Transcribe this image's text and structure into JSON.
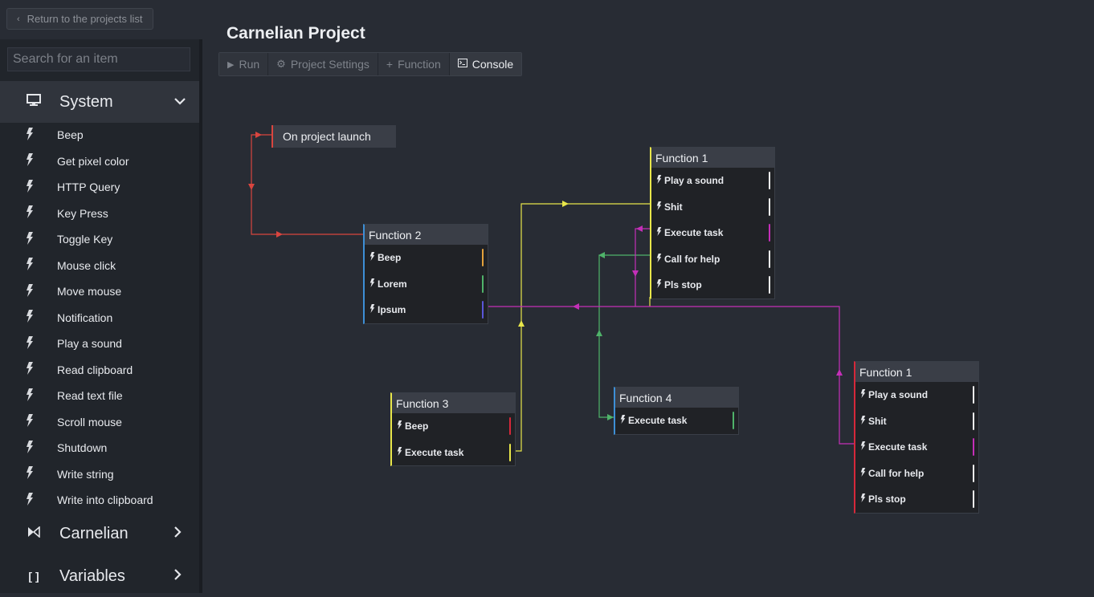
{
  "return_button": {
    "label": "Return to the projects list",
    "icon": "chevron-left-icon"
  },
  "search": {
    "placeholder": "Search for an item"
  },
  "sidebar": {
    "categories": [
      {
        "label": "System",
        "icon": "monitor-icon",
        "expanded": true
      },
      {
        "label": "Carnelian",
        "icon": "carnelian-logo-icon",
        "expanded": false
      },
      {
        "label": "Variables",
        "icon": "brackets-icon",
        "expanded": false
      }
    ],
    "system_items": [
      "Beep",
      "Get pixel color",
      "HTTP Query",
      "Key Press",
      "Toggle Key",
      "Mouse click",
      "Move mouse",
      "Notification",
      "Play a sound",
      "Read clipboard",
      "Read text file",
      "Scroll mouse",
      "Shutdown",
      "Write string",
      "Write into clipboard"
    ]
  },
  "project": {
    "title": "Carnelian Project"
  },
  "toolbar": {
    "run": "Run",
    "settings": "Project Settings",
    "function": "Function",
    "console": "Console"
  },
  "colors": {
    "red": "#d9453f",
    "yellow": "#e8e64a",
    "green": "#4fb36a",
    "magenta": "#c42fb8",
    "blue": "#3d8fd6",
    "orange": "#e3a13b",
    "indigo": "#5a56d9",
    "crimson": "#d6283a",
    "white": "#f0f0f0"
  },
  "canvas": {
    "trigger": {
      "label": "On project launch"
    },
    "nodes": [
      {
        "title": "Function 1",
        "accent": "#e8e64a",
        "rows": [
          {
            "label": "Play a sound",
            "port": "#f0f0f0"
          },
          {
            "label": "Shit",
            "port": "#f0f0f0"
          },
          {
            "label": "Execute task",
            "port": "#c42fb8"
          },
          {
            "label": "Call for help",
            "port": "#f0f0f0"
          },
          {
            "label": "Pls stop",
            "port": "#f0f0f0"
          }
        ]
      },
      {
        "title": "Function 2",
        "accent": "#3d8fd6",
        "rows": [
          {
            "label": "Beep",
            "port": "#e3a13b"
          },
          {
            "label": "Lorem",
            "port": "#4fb36a"
          },
          {
            "label": "Ipsum",
            "port": "#5a56d9"
          }
        ]
      },
      {
        "title": "Function 3",
        "accent": "#e8e64a",
        "rows": [
          {
            "label": "Beep",
            "port": "#d6283a"
          },
          {
            "label": "Execute task",
            "port": "#e8e64a"
          }
        ]
      },
      {
        "title": "Function 4",
        "accent": "#3d8fd6",
        "rows": [
          {
            "label": "Execute task",
            "port": "#4fb36a"
          }
        ]
      },
      {
        "title": "Function 1",
        "accent": "#d6283a",
        "rows": [
          {
            "label": "Play a sound",
            "port": "#f0f0f0"
          },
          {
            "label": "Shit",
            "port": "#f0f0f0"
          },
          {
            "label": "Execute task",
            "port": "#c42fb8"
          },
          {
            "label": "Call for help",
            "port": "#f0f0f0"
          },
          {
            "label": "Pls stop",
            "port": "#f0f0f0"
          }
        ]
      }
    ]
  }
}
